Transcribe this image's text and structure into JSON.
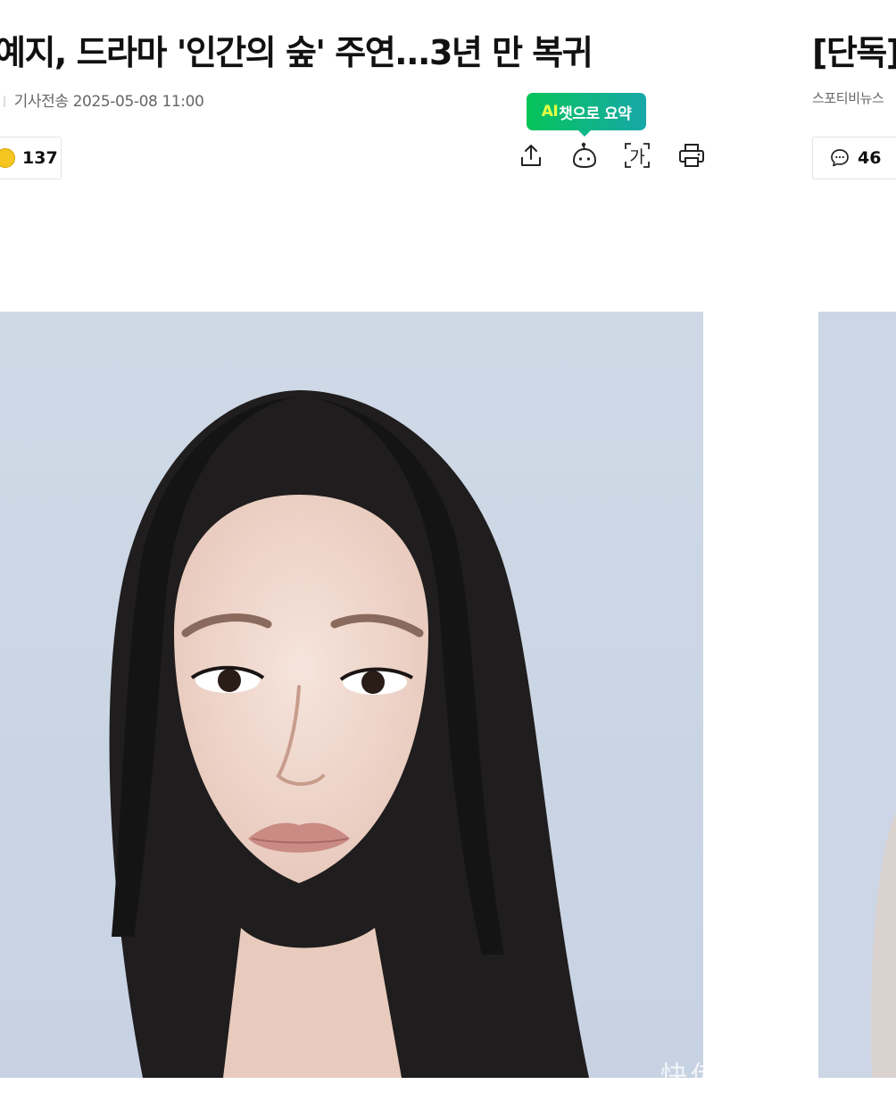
{
  "article_left": {
    "headline": "예지, 드라마 '인간의 숲' 주연...3년 만 복귀",
    "byline_prefix": "",
    "byline_label": "기사전송",
    "byline_date": "2025-05-08 11:00",
    "reaction_count": "137",
    "ai_badge": {
      "ai": "AI",
      "text": "챗으로 요약"
    },
    "toolbar": [
      {
        "icon": "share-icon"
      },
      {
        "icon": "ai-chat-robot-icon"
      },
      {
        "icon": "font-size-icon",
        "glyph": "가"
      },
      {
        "icon": "print-icon"
      }
    ]
  },
  "article_right": {
    "headline": "[단독]",
    "byline": "스포티비뉴스",
    "comment_count": "46"
  },
  "watermark": "快传　　　娱乐"
}
